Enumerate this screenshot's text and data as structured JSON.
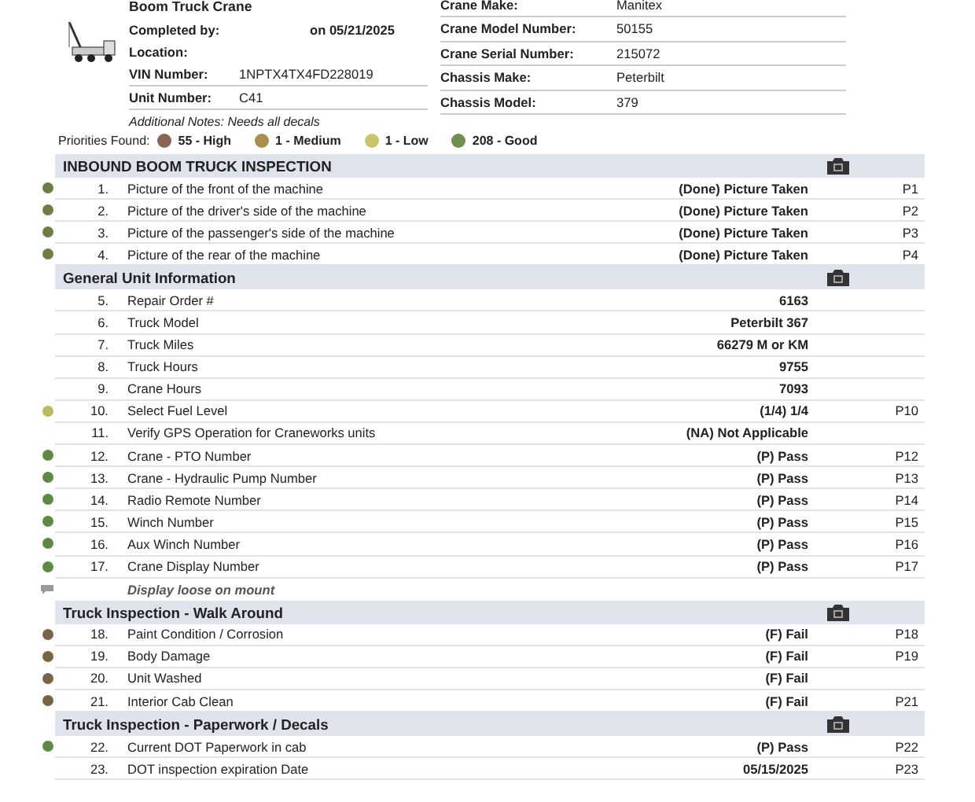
{
  "header": {
    "title": "Boom Truck Crane",
    "left_fields": [
      {
        "kind": "summary",
        "label": "Completed by:",
        "value": "on 05/21/2025"
      },
      {
        "kind": "summary",
        "label": "Location:"
      },
      {
        "kind": "detail",
        "label": "VIN Number:",
        "value": "1NPTX4TX4FD228019"
      },
      {
        "kind": "detail",
        "label": "Unit Number:",
        "value": "C41"
      }
    ],
    "right_fields": [
      {
        "label": "Crane Make:",
        "value": "Manitex"
      },
      {
        "label": "Crane Model Number:",
        "value": "50155"
      },
      {
        "label": "Crane Serial Number:",
        "value": "215072"
      },
      {
        "label": "Chassis Make:",
        "value": "Peterbilt"
      },
      {
        "label": "Chassis Model:",
        "value": "379"
      }
    ],
    "notes": "Additional Notes: Needs all decals"
  },
  "priorities": {
    "label": "Priorities Found:",
    "items": [
      {
        "text": "55 - High",
        "color": "#8a6454"
      },
      {
        "text": "1 - Medium",
        "color": "#a8904e"
      },
      {
        "text": "1 - Low",
        "color": "#c9c66a"
      },
      {
        "text": "208 - Good",
        "color": "#6e8f4e"
      }
    ]
  },
  "sections": [
    {
      "title": "INBOUND BOOM TRUCK INSPECTION",
      "rows": [
        {
          "kind": "item",
          "number": "1.",
          "label": "Picture of the front of the machine",
          "result": "(Done) Picture Taken",
          "photo": "P1",
          "color": "#6e7f45"
        },
        {
          "kind": "item",
          "number": "2.",
          "label": "Picture of the driver's side of the machine",
          "result": "(Done) Picture Taken",
          "photo": "P2",
          "color": "#6e7f45"
        },
        {
          "kind": "item",
          "number": "3.",
          "label": "Picture of the passenger's side of the machine",
          "result": "(Done) Picture Taken",
          "photo": "P3",
          "color": "#6e7f45"
        },
        {
          "kind": "item",
          "number": "4.",
          "label": "Picture of the rear of the machine",
          "result": "(Done) Picture Taken",
          "photo": "P4",
          "color": "#6e7f45"
        }
      ]
    },
    {
      "title": "General Unit Information",
      "rows": [
        {
          "kind": "item",
          "number": "5.",
          "label": "Repair Order #",
          "result": "6163"
        },
        {
          "kind": "item",
          "number": "6.",
          "label": "Truck Model",
          "result": "Peterbilt 367"
        },
        {
          "kind": "item",
          "number": "7.",
          "label": "Truck Miles",
          "result": "66279 M or KM"
        },
        {
          "kind": "item",
          "number": "8.",
          "label": "Truck Hours",
          "result": "9755"
        },
        {
          "kind": "item",
          "number": "9.",
          "label": "Crane Hours",
          "result": "7093"
        },
        {
          "kind": "item",
          "number": "10.",
          "label": "Select Fuel Level",
          "result": "(1/4) 1/4",
          "photo": "P10",
          "color": "#b5bb5e"
        },
        {
          "kind": "item",
          "number": "11.",
          "label": "Verify GPS Operation for Craneworks units",
          "result": "(NA) Not Applicable"
        },
        {
          "kind": "item",
          "number": "12.",
          "label": "Crane - PTO Number",
          "result": "(P) Pass",
          "photo": "P12",
          "color": "#5f8a45"
        },
        {
          "kind": "item",
          "number": "13.",
          "label": "Crane - Hydraulic Pump Number",
          "result": "(P) Pass",
          "photo": "P13",
          "color": "#5f8a45"
        },
        {
          "kind": "item",
          "number": "14.",
          "label": "Radio Remote Number",
          "result": "(P) Pass",
          "photo": "P14",
          "color": "#5f8a45"
        },
        {
          "kind": "item",
          "number": "15.",
          "label": "Winch Number",
          "result": "(P) Pass",
          "photo": "P15",
          "color": "#5f8a45"
        },
        {
          "kind": "item",
          "number": "16.",
          "label": "Aux Winch Number",
          "result": "(P) Pass",
          "photo": "P16",
          "color": "#5f8a45"
        },
        {
          "kind": "item",
          "number": "17.",
          "label": "Crane Display Number",
          "result": "(P) Pass",
          "photo": "P17",
          "color": "#5f8a45"
        },
        {
          "kind": "note",
          "label": "Display loose on mount"
        }
      ]
    },
    {
      "title": "Truck Inspection - Walk Around",
      "rows": [
        {
          "kind": "item",
          "number": "18.",
          "label": "Paint Condition / Corrosion",
          "result": "(F) Fail",
          "photo": "P18",
          "color": "#7a6448"
        },
        {
          "kind": "item",
          "number": "19.",
          "label": "Body Damage",
          "result": "(F) Fail",
          "photo": "P19",
          "color": "#7a6448"
        },
        {
          "kind": "item",
          "number": "20.",
          "label": "Unit Washed",
          "result": "(F) Fail",
          "color": "#7a6448"
        },
        {
          "kind": "item",
          "number": "21.",
          "label": "Interior Cab Clean",
          "result": "(F) Fail",
          "photo": "P21",
          "color": "#7a6448"
        }
      ]
    },
    {
      "title": "Truck Inspection - Paperwork / Decals",
      "rows": [
        {
          "kind": "item",
          "number": "22.",
          "label": "Current DOT Paperwork in cab",
          "result": "(P) Pass",
          "photo": "P22",
          "color": "#5f8a45"
        },
        {
          "kind": "item",
          "number": "23.",
          "label": "DOT inspection expiration Date",
          "result": "05/15/2025",
          "photo": "P23"
        }
      ]
    }
  ]
}
